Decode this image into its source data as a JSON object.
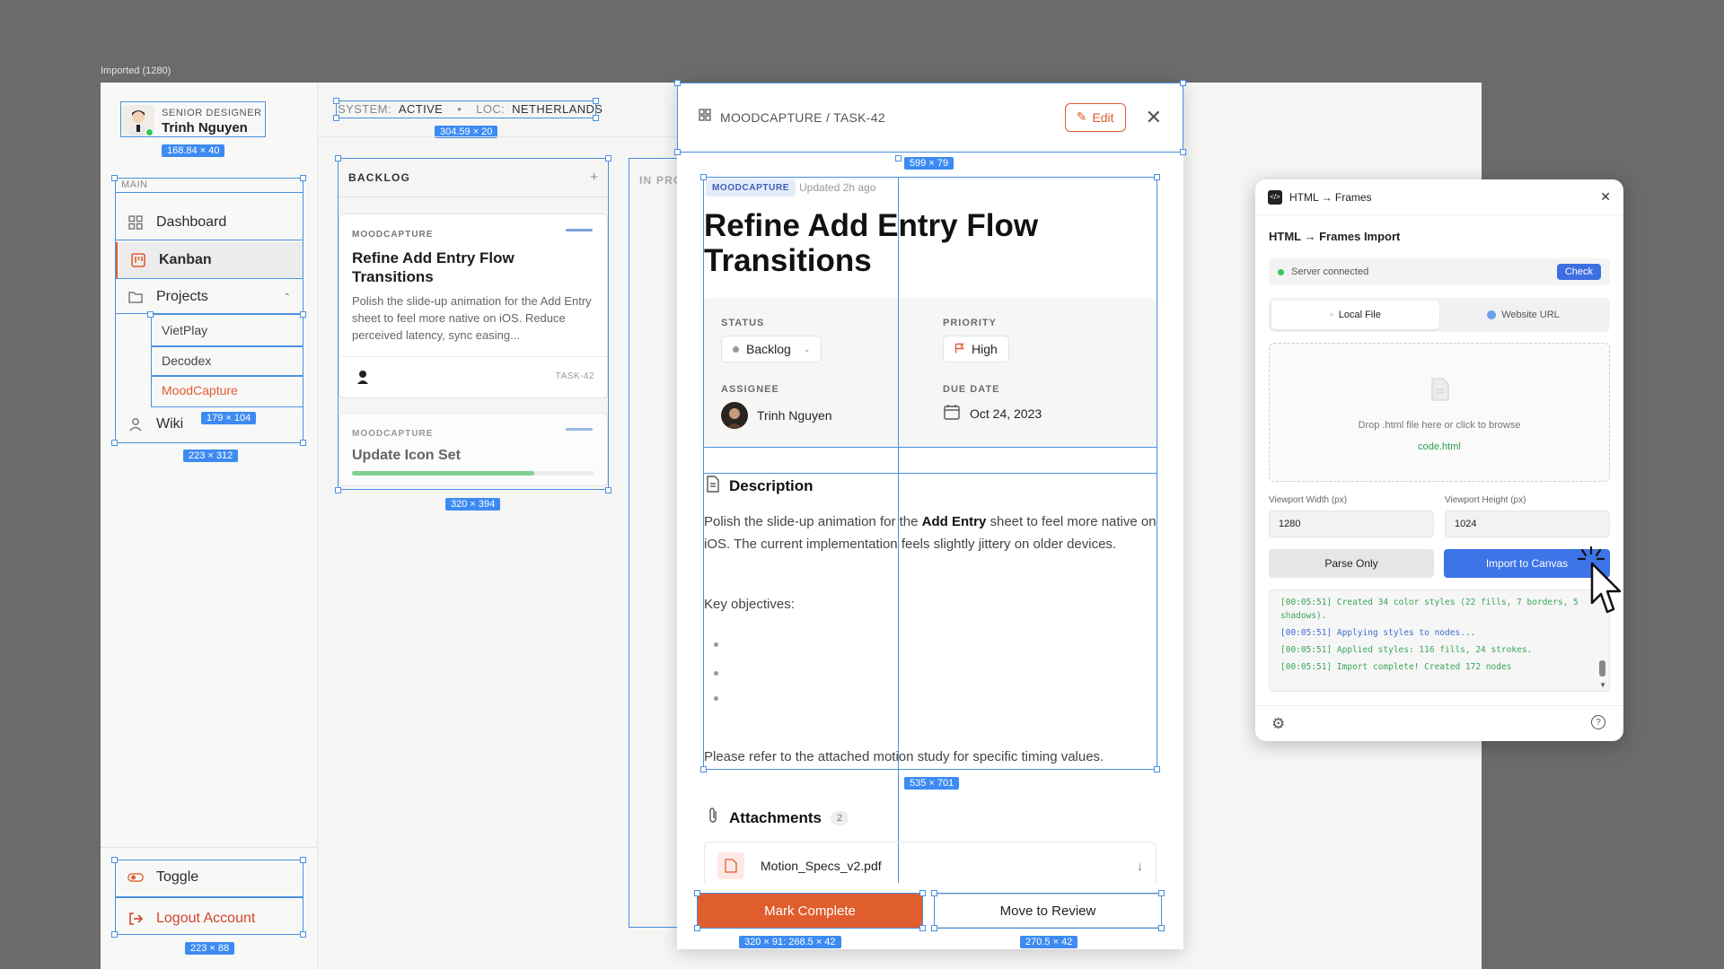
{
  "frame": {
    "label": "Imported (1280)"
  },
  "profile": {
    "role": "SENIOR DESIGNER",
    "name": "Trinh Nguyen",
    "dim": "168.84 × 40"
  },
  "status_bar": {
    "system_label": "SYSTEM:",
    "system_value": "ACTIVE",
    "separator": "•",
    "loc_label": "LOC:",
    "loc_value": "NETHERLANDS",
    "dim": "304.59 × 20"
  },
  "sidebar": {
    "section": "MAIN",
    "items": [
      {
        "label": "Dashboard",
        "icon": "grid-icon"
      },
      {
        "label": "Kanban",
        "icon": "kanban-icon",
        "active": true
      },
      {
        "label": "Projects",
        "icon": "folder-icon"
      },
      {
        "label": "Wiki",
        "icon": "user-icon"
      }
    ],
    "projects": [
      "VietPlay",
      "Decodex",
      "MoodCapture"
    ],
    "projects_dim": "179 × 104",
    "nav_dim": "223 × 312",
    "toggle": "Toggle",
    "logout": "Logout Account",
    "bottom_dim": "223 × 88",
    "accent": "#e05d2e"
  },
  "kanban": {
    "backlog_title": "BACKLOG",
    "add_symbol": "+",
    "in_progress_title": "IN PRO",
    "column_dim": "320 × 394",
    "cards": [
      {
        "project": "MOODCAPTURE",
        "title": "Refine Add Entry Flow Transitions",
        "desc": "Polish the slide-up animation for the Add Entry sheet to feel more native on iOS. Reduce perceived latency, sync easing...",
        "id": "TASK-42"
      },
      {
        "project": "MOODCAPTURE",
        "title": "Update Icon Set",
        "progress": 0.75
      }
    ]
  },
  "detail": {
    "breadcrumb": "MOODCAPTURE / TASK-42",
    "edit": "Edit",
    "header_dim": "599 × 79",
    "tag": "MOODCAPTURE",
    "updated": "Updated 2h ago",
    "title": "Refine Add Entry Flow Transitions",
    "status_label": "STATUS",
    "status_value": "Backlog",
    "priority_label": "PRIORITY",
    "priority_value": "High",
    "assignee_label": "ASSIGNEE",
    "assignee_value": "Trinh Nguyen",
    "due_label": "DUE DATE",
    "due_value": "Oct 24, 2023",
    "description_heading": "Description",
    "desc_before": "Polish the slide-up animation for the ",
    "desc_bold": "Add Entry",
    "desc_after": " sheet to feel more native on iOS. The current implementation feels slightly jittery on older devices.",
    "objectives_heading": "Key objectives:",
    "footer_note": "Please refer to the attached motion study for specific timing values.",
    "content_dim": "535 × 701",
    "attachments_heading": "Attachments",
    "attachments_count": "2",
    "attachment_file": "Motion_Specs_v2.pdf",
    "complete_btn": "Mark Complete",
    "complete_dim": "320 × 91: 268.5 × 42",
    "review_btn": "Move to Review",
    "review_dim": "270.5 × 42"
  },
  "plugin": {
    "title": "HTML → Frames",
    "heading": "HTML → Frames Import",
    "server_status": "Server connected",
    "check": "Check",
    "tab_local": "Local File",
    "tab_url": "Website URL",
    "drop_text": "Drop .html file here or click to browse",
    "file_name": "code.html",
    "vw_label": "Viewport Width (px)",
    "vw_value": "1280",
    "vh_label": "Viewport Height (px)",
    "vh_value": "1024",
    "parse_btn": "Parse Only",
    "import_btn": "Import to Canvas",
    "logs": [
      "[00:05:51] Created 34 color styles (22 fills, 7 borders, 5 shadows).",
      "[00:05:51] Applying styles to nodes...",
      "[00:05:51] Applied styles: 116 fills, 24 strokes.",
      "[00:05:51] Import complete! Created 172 nodes"
    ]
  }
}
